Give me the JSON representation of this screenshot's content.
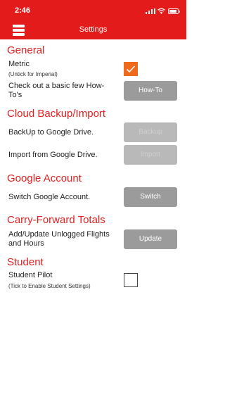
{
  "status_bar": {
    "time": "2:46"
  },
  "nav": {
    "title": "Settings",
    "menu_icon": "hamburger-menu-icon"
  },
  "colors": {
    "brand": "#e31b1b",
    "section_title": "#e01f1f",
    "checkbox_on": "#f06a1c",
    "button": "#9b9b9b"
  },
  "general": {
    "header": "General",
    "metric_label": "Metric",
    "metric_sub": "(Untick for Imperial)",
    "metric_checked": true,
    "howto_label": "Check out a basic few How-To's",
    "howto_button": "How-To"
  },
  "cloud": {
    "header": "Cloud Backup/Import",
    "backup_label": "BackUp to Google Drive.",
    "backup_button": "Backup",
    "import_label": "Import from Google Drive.",
    "import_button": "Import"
  },
  "google": {
    "header": "Google Account",
    "switch_label": "Switch Google Account.",
    "switch_button": "Switch"
  },
  "carry": {
    "header": "Carry-Forward Totals",
    "update_label": "Add/Update Unlogged Flights and Hours",
    "update_button": "Update"
  },
  "student": {
    "header": "Student",
    "pilot_label": "Student Pilot",
    "pilot_sub": "(Tick to Enable Student Settings)",
    "pilot_checked": false
  }
}
